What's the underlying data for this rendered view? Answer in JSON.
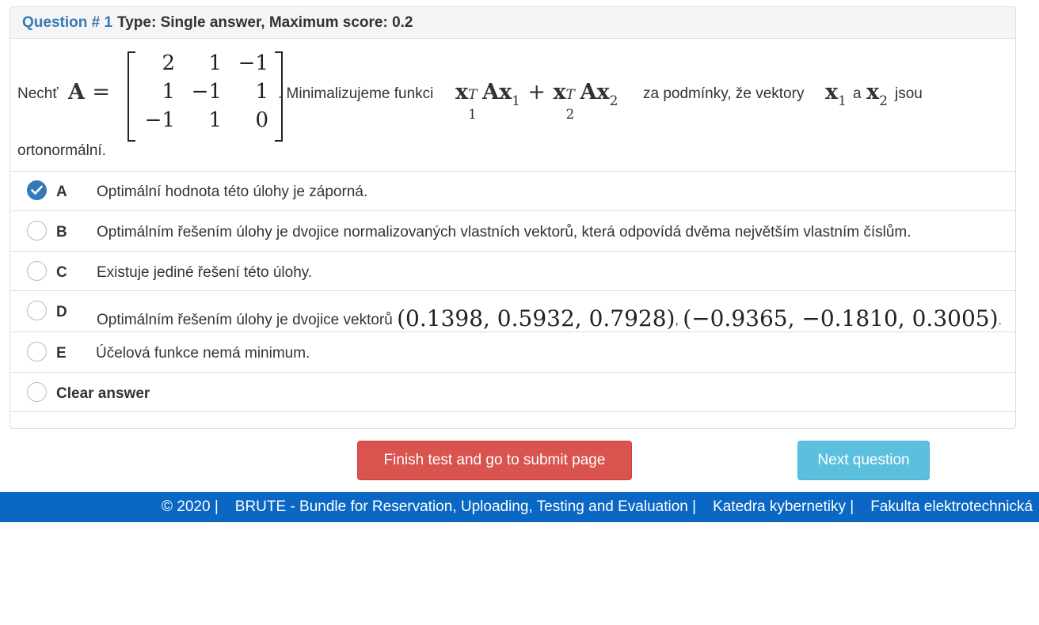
{
  "header": {
    "question_number": "Question # 1",
    "question_type": "Type: Single answer, Maximum score: 0.2"
  },
  "question": {
    "intro": "Nechť",
    "matrix_name": "A",
    "matrix_rows": [
      [
        "2",
        "1",
        "−1"
      ],
      [
        "1",
        "−1",
        "1"
      ],
      [
        "−1",
        "1",
        "0"
      ]
    ],
    "text_after_matrix": ". Minimalizujeme funkci",
    "expression_vec": "x",
    "expression_sup": "T",
    "expression_mat": "A",
    "plus": "+",
    "sub1": "1",
    "sub2": "2",
    "text_conditions": "za podmínky, že vektory",
    "text_and": "a",
    "text_jsou": "jsou",
    "text_last_line": "ortonormální."
  },
  "options": [
    {
      "letter": "A",
      "text": "Optimální hodnota této úlohy je záporná.",
      "selected": true
    },
    {
      "letter": "B",
      "text": "Optimálním řešením úlohy je dvojice normalizovaných vlastních vektorů, která odpovídá dvěma největším vlastním číslům.",
      "selected": false
    },
    {
      "letter": "C",
      "text": "Existuje jediné řešení této úlohy.",
      "selected": false
    },
    {
      "letter": "D",
      "text": "Optimálním řešením úlohy je dvojice vektorů",
      "math1": "(0.1398, 0.5932, 0.7928)",
      "math2": "(−0.9365, −0.1810, 0.3005)",
      "sep": ",",
      "end": ".",
      "selected": false
    },
    {
      "letter": "E",
      "text": "Účelová funkce nemá minimum.",
      "selected": false
    }
  ],
  "clear_answer": "Clear answer",
  "buttons": {
    "finish": "Finish test and go to submit page",
    "next": "Next question"
  },
  "footer": {
    "copyright": "© 2020 |",
    "brute": "BRUTE - Bundle for Reservation, Uploading, Testing and Evaluation |",
    "katedra": "Katedra kybernetiky |",
    "fakulta": "Fakulta elektrotechnická"
  },
  "colors": {
    "accent": "#337ab7",
    "danger": "#d9534f",
    "info": "#5bc0de",
    "footer": "#0a68c4"
  }
}
